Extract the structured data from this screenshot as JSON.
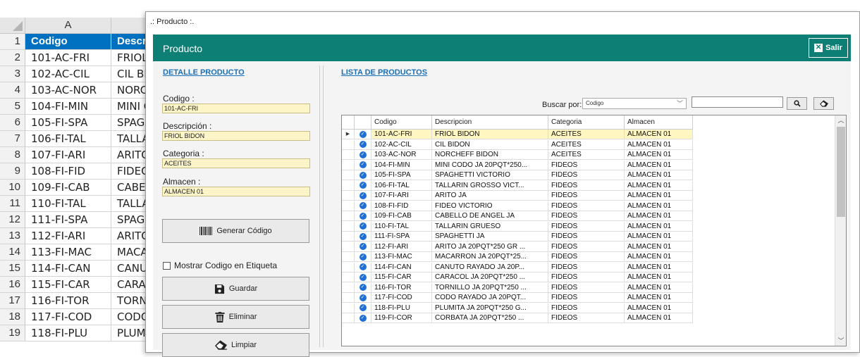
{
  "excel": {
    "col_a": "A",
    "rownums": [
      "1",
      "2",
      "3",
      "4",
      "5",
      "6",
      "7",
      "8",
      "9",
      "10",
      "11",
      "12",
      "13",
      "14",
      "15",
      "16",
      "17",
      "18",
      "19"
    ],
    "header": {
      "codigo": "Codigo",
      "descr": "Descri"
    },
    "rows": [
      {
        "a": "101-AC-FRI",
        "b": "FRIOL"
      },
      {
        "a": "102-AC-CIL",
        "b": "CIL BID"
      },
      {
        "a": "103-AC-NOR",
        "b": "NORCH"
      },
      {
        "a": "104-FI-MIN",
        "b": "MINI C"
      },
      {
        "a": "105-FI-SPA",
        "b": "SPAGH"
      },
      {
        "a": "106-FI-TAL",
        "b": "TALLA"
      },
      {
        "a": "107-FI-ARI",
        "b": "ARITO"
      },
      {
        "a": "108-FI-FID",
        "b": "FIDEO"
      },
      {
        "a": "109-FI-CAB",
        "b": "CABEL"
      },
      {
        "a": "110-FI-TAL",
        "b": "TALLA"
      },
      {
        "a": "111-FI-SPA",
        "b": "SPAGH"
      },
      {
        "a": "112-FI-ARI",
        "b": "ARITO"
      },
      {
        "a": "113-FI-MAC",
        "b": "MACA"
      },
      {
        "a": "114-FI-CAN",
        "b": "CANUT"
      },
      {
        "a": "115-FI-CAR",
        "b": "CARAC"
      },
      {
        "a": "116-FI-TOR",
        "b": "TORNI"
      },
      {
        "a": "117-FI-COD",
        "b": "CODO"
      },
      {
        "a": "118-FI-PLU",
        "b": "PLUM"
      }
    ]
  },
  "window": {
    "title": ".: Producto :.",
    "header_title": "Producto",
    "salir_label": "Salir",
    "accent": "#0e7f74"
  },
  "detalle": {
    "title": "DETALLE PRODUCTO",
    "codigo_label": "Codigo :",
    "codigo_value": "101-AC-FRI",
    "descripcion_label": "Descripción :",
    "descripcion_value": "FRIOL BIDON",
    "categoria_label": "Categoria :",
    "categoria_value": "ACEITES",
    "almacen_label": "Almacen :",
    "almacen_value": "ALMACEN 01",
    "generar_label": "Generar Código",
    "mostrar_label": "Mostrar Codigo en Etiqueta",
    "guardar_label": "Guardar",
    "eliminar_label": "Eliminar",
    "limpiar_label": "Limpiar"
  },
  "lista": {
    "title": "LISTA DE PRODUCTOS",
    "buscar_label": "Buscar por:",
    "combo_value": "Codigo",
    "columns": [
      "Codigo",
      "Descripcion",
      "Categoria",
      "Almacen"
    ],
    "rows": [
      [
        "101-AC-FRI",
        "FRIOL BIDON",
        "ACEITES",
        "ALMACEN 01"
      ],
      [
        "102-AC-CIL",
        "CIL BIDON",
        "ACEITES",
        "ALMACEN 01"
      ],
      [
        "103-AC-NOR",
        "NORCHEFF BIDON",
        "ACEITES",
        "ALMACEN 01"
      ],
      [
        "104-FI-MIN",
        "MINI CODO JA 20PQT*250...",
        "FIDEOS",
        "ALMACEN 01"
      ],
      [
        "105-FI-SPA",
        "SPAGHETTI VICTORIO",
        "FIDEOS",
        "ALMACEN  01"
      ],
      [
        "106-FI-TAL",
        "TALLARIN GROSSO VICT...",
        "FIDEOS",
        "ALMACEN 01"
      ],
      [
        "107-FI-ARI",
        "ARITO JA",
        "FIDEOS",
        "ALMACEN 01"
      ],
      [
        "108-FI-FID",
        "FIDEO VICTORIO",
        "FIDEOS",
        "ALMACEN 01"
      ],
      [
        "109-FI-CAB",
        "CABELLO DE ANGEL JA",
        "FIDEOS",
        "ALMACEN 01"
      ],
      [
        "110-FI-TAL",
        "TALLARIN GRUESO",
        "FIDEOS",
        "ALMACEN 01"
      ],
      [
        "111-FI-SPA",
        "SPAGHETTI JA",
        "FIDEOS",
        "ALMACEN 01"
      ],
      [
        "112-FI-ARI",
        "ARITO JA 20PQT*250 GR ...",
        "FIDEOS",
        "ALMACEN 01"
      ],
      [
        "113-FI-MAC",
        "MACARRON JA 20PQT*25...",
        "FIDEOS",
        "ALMACEN 01"
      ],
      [
        "114-FI-CAN",
        "CANUTO RAYADO JA 20P...",
        "FIDEOS",
        "ALMACEN 01"
      ],
      [
        "115-FI-CAR",
        "CARACOL JA 20PQT*250 ...",
        "FIDEOS",
        "ALMACEN 01"
      ],
      [
        "116-FI-TOR",
        "TORNILLO JA 20PQT*250 ...",
        "FIDEOS",
        "ALMACEN 01"
      ],
      [
        "117-FI-COD",
        "CODO RAYADO JA 20PQT...",
        "FIDEOS",
        "ALMACEN 01"
      ],
      [
        "118-FI-PLU",
        "PLUMITA JA 20PQT*250 G...",
        "FIDEOS",
        "ALMACEN 01"
      ],
      [
        "119-FI-COR",
        "CORBATA JA 20PQT*250 ...",
        "FIDEOS",
        "ALMACEN 01"
      ]
    ]
  }
}
